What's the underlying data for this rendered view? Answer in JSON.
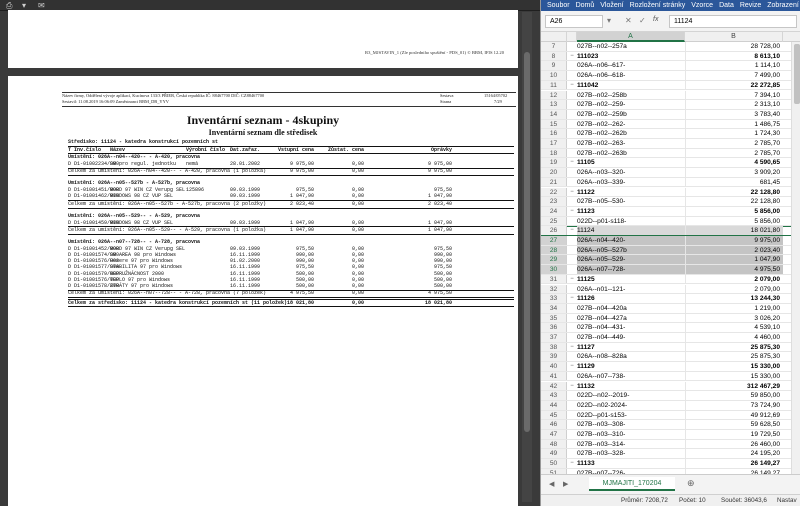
{
  "pdf": {
    "page1_header": "R3_MJSTAVIN_1 (Zle posledniho spuštění - PDS_01) © BBM, IFIS 12.20",
    "meta": {
      "firma": "Název firmy, Oddělení vývoje aplikací, Kucínova 133/3 PŘIER, Česká republika  IČ: 88467700  DIČ: CZ88467700",
      "sestavil": "Sestavil: 11.08.2019 16:06:09 Zaměstnanci BBM_DB_YYV",
      "sestava_lbl": "Sestava",
      "sestava_val": "15164/05702",
      "strana_lbl": "Strana",
      "strana_val": "7/29"
    },
    "title": "Inventární seznam - 4skupiny",
    "subtitle": "Inventární seznam dle středisek",
    "stredisko": "Středisko: 11124 - katedra konstrukcí pozemních st",
    "columns": [
      "T Inv.číslo",
      "Název",
      "Výrobní číslo",
      "Dat.zařaz.",
      "Vstupní cena",
      "Zůstat. cena",
      "Oprávky"
    ],
    "groups": [
      {
        "header": "Umístění: 026A--n04--420-- - A-420, pracovna",
        "rows": [
          [
            "D D1-01002234/000",
            "SW pro regul. jednotku",
            "nemá",
            "28.01.2002",
            "9 975,00",
            "0,00",
            "9 975,00"
          ]
        ],
        "total": [
          "Celkem za umístění: 026A--n04--420-- - A-420, pracovna (1 položka)",
          "9 975,00",
          "0,00",
          "9 975,00"
        ]
      },
      {
        "header": "Umístění: 026A--n05--527b - A-527b, pracovna",
        "rows": [
          [
            "D D1-01001451/000",
            "WORD 97 WIN CZ Verupg SEL",
            "125896",
            "09.03.1999",
            "975,50",
            "0,00",
            "975,50"
          ],
          [
            "D D1-01001462/000",
            "WINDOWS 98 CZ VUP SEL",
            "",
            "09.03.1999",
            "1 047,90",
            "0,00",
            "1 047,90"
          ]
        ],
        "total": [
          "Celkem za umístění: 026A--n05--527b - A-527b, pracovna (2 položky)",
          "2 023,40",
          "0,00",
          "2 023,40"
        ]
      },
      {
        "header": "Umístění: 026A--n05--529-- - A-529, pracovna",
        "rows": [
          [
            "D D1-01001459/000",
            "WINDOWS 98 CZ VUP SEL",
            "",
            "09.03.1999",
            "1 047,90",
            "0,00",
            "1 047,90"
          ]
        ],
        "total": [
          "Celkem za umístění: 026A--n05--529-- - A-529, pracovna (1 položka)",
          "1 047,90",
          "0,00",
          "1 047,90"
        ]
      },
      {
        "header": "Umístění: 026A--n07--728-- - A-728, pracovna",
        "rows": [
          [
            "D D1-01001452/000",
            "WORD 97 WIN CZ Verupg SEL",
            "",
            "09.03.1999",
            "975,50",
            "0,00",
            "975,50"
          ],
          [
            "D D1-01001574/000",
            "SW AREA 98 pro Windows",
            "",
            "16.11.1999",
            "990,00",
            "0,00",
            "990,00"
          ],
          [
            "D D1-01001576/000",
            "Hezere 97 pro Windows",
            "",
            "01.02.2000",
            "990,00",
            "0,00",
            "990,00"
          ],
          [
            "D D1-01001577/000",
            "STABILITA 97 pro Windows",
            "",
            "16.11.1999",
            "975,50",
            "0,00",
            "975,50"
          ],
          [
            "D D1-01001579/000",
            "NEPRUŽNÁCNOST 2000",
            "",
            "16.11.1999",
            "500,00",
            "0,00",
            "500,00"
          ],
          [
            "D D1-01001576/000",
            "TEPLO 97 pro Windows",
            "",
            "16.11.1999",
            "500,00",
            "0,00",
            "500,00"
          ],
          [
            "D D1-01001578/000",
            "ZTRÁTY 97 pro Windows",
            "",
            "16.11.1999",
            "500,00",
            "0,00",
            "500,00"
          ]
        ],
        "total": [
          "Celkem za umístění: 026A--n07--728-- - A-728, pracovna (7 položek)",
          "4 975,50",
          "0,00",
          "4 975,50"
        ]
      }
    ],
    "grand_total": [
      "Celkem za středisko: 11124 - katedra konstrukcí pozemních st (11 položek)",
      "18 021,80",
      "0,00",
      "18 021,80"
    ]
  },
  "excel": {
    "ribbon_tabs": [
      "Soubor",
      "Domů",
      "Vložení",
      "Rozložení stránky",
      "Vzorce",
      "Data",
      "Revize",
      "Zobrazení"
    ],
    "name_box": "A26",
    "formula_value": "11124",
    "col_a": "A",
    "col_b": "B",
    "rows": [
      {
        "n": "7",
        "ctl": "",
        "a": "027B--n02--257a",
        "b": "28 728,00",
        "t": ""
      },
      {
        "n": "8",
        "ctl": "−",
        "a": "111023",
        "b": "8 613,10",
        "t": "sum"
      },
      {
        "n": "9",
        "ctl": "",
        "a": "026A--n06--617-",
        "b": "1 114,10",
        "t": ""
      },
      {
        "n": "10",
        "ctl": "",
        "a": "026A--n06--618-",
        "b": "7 499,00",
        "t": ""
      },
      {
        "n": "11",
        "ctl": "−",
        "a": "111042",
        "b": "22 272,85",
        "t": "sum"
      },
      {
        "n": "12",
        "ctl": "",
        "a": "027B--n02--258b",
        "b": "7 394,10",
        "t": ""
      },
      {
        "n": "13",
        "ctl": "",
        "a": "027B--n02--259-",
        "b": "2 313,10",
        "t": ""
      },
      {
        "n": "14",
        "ctl": "",
        "a": "027B--n02--259b",
        "b": "3 783,40",
        "t": ""
      },
      {
        "n": "15",
        "ctl": "",
        "a": "027B--n02--262-",
        "b": "1 486,75",
        "t": ""
      },
      {
        "n": "16",
        "ctl": "",
        "a": "027B--n02--262b",
        "b": "1 724,30",
        "t": ""
      },
      {
        "n": "17",
        "ctl": "",
        "a": "027B--n02--263-",
        "b": "2 785,70",
        "t": ""
      },
      {
        "n": "18",
        "ctl": "",
        "a": "027B--n02--263b",
        "b": "2 785,70",
        "t": ""
      },
      {
        "n": "19",
        "ctl": "−",
        "a": "11105",
        "b": "4 590,65",
        "t": "sum"
      },
      {
        "n": "20",
        "ctl": "",
        "a": "026A--n03--320-",
        "b": "3 909,20",
        "t": ""
      },
      {
        "n": "21",
        "ctl": "",
        "a": "026A--n03--339-",
        "b": "681,45",
        "t": ""
      },
      {
        "n": "22",
        "ctl": "−",
        "a": "11122",
        "b": "22 128,80",
        "t": "sum"
      },
      {
        "n": "23",
        "ctl": "",
        "a": "027B--n05--530-",
        "b": "22 128,80",
        "t": ""
      },
      {
        "n": "24",
        "ctl": "−",
        "a": "11123",
        "b": "5 856,00",
        "t": "sum"
      },
      {
        "n": "25",
        "ctl": "",
        "a": "022D--p01-s118-",
        "b": "5 856,00",
        "t": ""
      },
      {
        "n": "26",
        "ctl": "−",
        "a": "11124",
        "b": "18 021,80",
        "t": "act"
      },
      {
        "n": "27",
        "ctl": "",
        "a": "026A--n04--420-",
        "b": "9 975,00",
        "t": "hi"
      },
      {
        "n": "28",
        "ctl": "",
        "a": "026A--n05--527b",
        "b": "2 023,40",
        "t": "hi"
      },
      {
        "n": "29",
        "ctl": "",
        "a": "026A--n05--529-",
        "b": "1 047,90",
        "t": "hi"
      },
      {
        "n": "30",
        "ctl": "",
        "a": "026A--n07--728-",
        "b": "4 975,50",
        "t": "hi"
      },
      {
        "n": "31",
        "ctl": "−",
        "a": "11125",
        "b": "2 079,00",
        "t": "sum"
      },
      {
        "n": "32",
        "ctl": "",
        "a": "026A--n01--121-",
        "b": "2 079,00",
        "t": ""
      },
      {
        "n": "33",
        "ctl": "−",
        "a": "11126",
        "b": "13 244,30",
        "t": "sum"
      },
      {
        "n": "34",
        "ctl": "",
        "a": "027B--n04--420a",
        "b": "1 219,00",
        "t": ""
      },
      {
        "n": "35",
        "ctl": "",
        "a": "027B--n04--427a",
        "b": "3 026,20",
        "t": ""
      },
      {
        "n": "36",
        "ctl": "",
        "a": "027B--n04--431-",
        "b": "4 539,10",
        "t": ""
      },
      {
        "n": "37",
        "ctl": "",
        "a": "027B--n04--449-",
        "b": "4 460,00",
        "t": ""
      },
      {
        "n": "38",
        "ctl": "−",
        "a": "11127",
        "b": "25 875,30",
        "t": "sum"
      },
      {
        "n": "39",
        "ctl": "",
        "a": "026A--n08--828a",
        "b": "25 875,30",
        "t": ""
      },
      {
        "n": "40",
        "ctl": "−",
        "a": "11129",
        "b": "15 330,00",
        "t": "sum"
      },
      {
        "n": "41",
        "ctl": "",
        "a": "026A--n07--738-",
        "b": "15 330,00",
        "t": ""
      },
      {
        "n": "42",
        "ctl": "−",
        "a": "11132",
        "b": "312 467,29",
        "t": "sum"
      },
      {
        "n": "43",
        "ctl": "",
        "a": "022D--n02--2019-",
        "b": "59 850,00",
        "t": ""
      },
      {
        "n": "44",
        "ctl": "",
        "a": "022D--n02-2024-",
        "b": "73 724,90",
        "t": ""
      },
      {
        "n": "45",
        "ctl": "",
        "a": "022D--p01-s153-",
        "b": "49 912,69",
        "t": ""
      },
      {
        "n": "46",
        "ctl": "",
        "a": "027B--n03--308-",
        "b": "59 628,50",
        "t": ""
      },
      {
        "n": "47",
        "ctl": "",
        "a": "027B--n03--310-",
        "b": "19 729,50",
        "t": ""
      },
      {
        "n": "48",
        "ctl": "",
        "a": "027B--n03--314-",
        "b": "26 460,00",
        "t": ""
      },
      {
        "n": "49",
        "ctl": "",
        "a": "027B--n03--328-",
        "b": "24 195,20",
        "t": ""
      },
      {
        "n": "50",
        "ctl": "−",
        "a": "11133",
        "b": "26 149,27",
        "t": "sum"
      },
      {
        "n": "51",
        "ctl": "",
        "a": "027B--n07--726-",
        "b": "26 149,27",
        "t": ""
      }
    ],
    "sheet_tab": "MJMAJITI_170204",
    "status": {
      "prumer": "Průměr: 7208,72",
      "pocet": "Počet: 10",
      "soucet": "Součet: 36043,6",
      "nast": "Nastav"
    }
  }
}
